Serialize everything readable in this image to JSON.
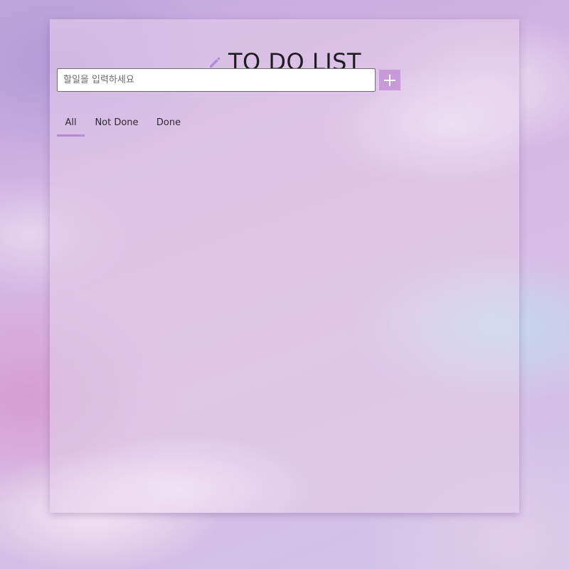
{
  "header": {
    "title": "TO DO LIST",
    "icon": "pencil-icon"
  },
  "input": {
    "value": "",
    "placeholder": "할일을 입력하세요"
  },
  "add_button": {
    "icon": "plus-icon"
  },
  "tabs": [
    {
      "label": "All",
      "selected": true
    },
    {
      "label": "Not Done",
      "selected": false
    },
    {
      "label": "Done",
      "selected": false
    }
  ],
  "tasks": [],
  "colors": {
    "accent": "#b58ad6",
    "add_button": "#c89ad8",
    "title_text": "#1f1d24"
  }
}
